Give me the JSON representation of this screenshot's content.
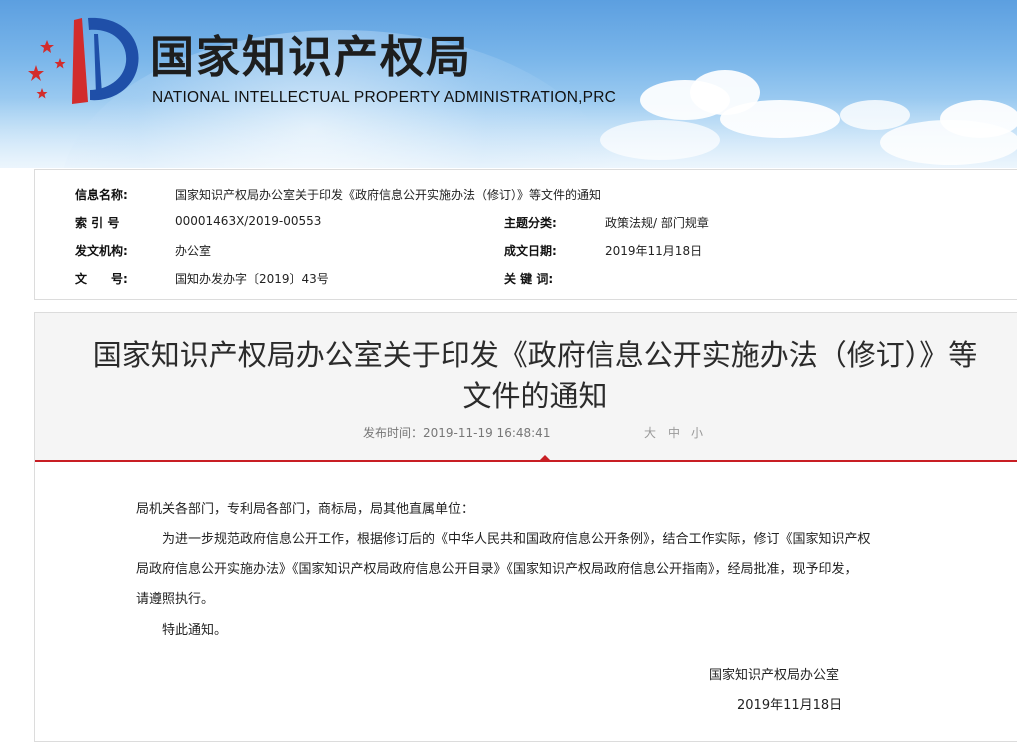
{
  "banner": {
    "title_cn": "国家知识产权局",
    "title_en": "NATIONAL INTELLECTUAL PROPERTY ADMINISTRATION,PRC",
    "colors": {
      "sky": "#6aaae6",
      "logo_red": "#d22c2c",
      "logo_blue": "#1f4fa8"
    }
  },
  "info": {
    "title_label": "信息名称:",
    "title_value": "国家知识产权局办公室关于印发《政府信息公开实施办法（修订）》等文件的通知",
    "index_label": "索 引 号",
    "index_value": "00001463X/2019-00553",
    "category_label": "主题分类:",
    "category_value": "政策法规/ 部门规章",
    "issuer_label": "发文机构:",
    "issuer_value": "办公室",
    "date_label": "成文日期:",
    "date_value": "2019年11月18日",
    "docno_label": "文　　号:",
    "docno_value": "国知办发办字〔2019〕43号",
    "keywords_label": "关 键 词:",
    "keywords_value": ""
  },
  "article": {
    "title_line1": "国家知识产权局办公室关于印发《政府信息公开实施办法（修订）》等",
    "title_line2": "文件的通知",
    "publish_time": "发布时间：2019-11-19 16:48:41",
    "font_size_large": "大",
    "font_size_medium": "中",
    "font_size_small": "小",
    "salutation": "局机关各部门，专利局各部门，商标局，局其他直属单位：",
    "para1_line1": "为进一步规范政府信息公开工作，根据修订后的《中华人民共和国政府信息公开条例》，结合工作实际，修订《国家知识产权",
    "para1_line2": "局政府信息公开实施办法》《国家知识产权局政府信息公开目录》《国家知识产权局政府信息公开指南》，经局批准，现予印发，",
    "para1_line3": "请遵照执行。",
    "para2": "特此通知。",
    "signature": "国家知识产权局办公室",
    "signature_date": "2019年11月18日",
    "accent": "#c81e24"
  }
}
